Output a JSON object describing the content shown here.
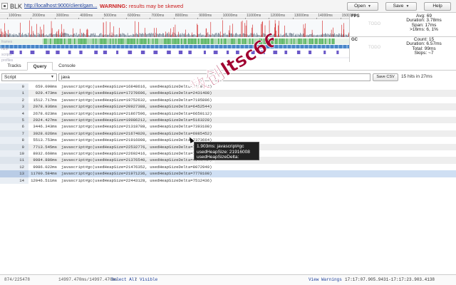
{
  "app": {
    "name": "BLK",
    "url": "http://localhost:9000/client/gam...",
    "warning_label": "WARNING:",
    "warning_text": "results may be skewed"
  },
  "toolbar": {
    "open_label": "Open",
    "save_label": "Save",
    "help_label": "Help"
  },
  "timeline": {
    "ruler_ticks": [
      "1000ms",
      "2000ms",
      "3000ms",
      "4000ms",
      "5000ms",
      "6000ms",
      "7000ms",
      "8000ms",
      "9000ms",
      "10000ms",
      "11000ms",
      "12000ms",
      "13000ms",
      "14000ms",
      "15000ms"
    ],
    "track_labels": [
      "frames",
      "html",
      "scripts",
      "profiles"
    ]
  },
  "fps_panel": {
    "tag": "FPS",
    "todo": "TODO",
    "stats": [
      "Avg: 69",
      "Duration: 3.78ms",
      "Span: 17ms",
      ">16ms: 6, 1%"
    ]
  },
  "gc_panel": {
    "tag": "GC",
    "todo": "TODO",
    "stats": [
      "Count: 15",
      "Duration: 6.57ms",
      "Total: 99ms",
      "Skips: ~7"
    ]
  },
  "tabs": [
    "Tracks",
    "Query",
    "Console"
  ],
  "active_tab": "Query",
  "query": {
    "language": "Script",
    "value": "java",
    "save_csv_label": "Save CSV",
    "hits_text": "15 hits in 27ms"
  },
  "results": [
    {
      "index": "0",
      "time": "659.090ms",
      "text": "javascript#gc(usedHeapSize=16848616, usedHeapSizeDelta=2180744)"
    },
    {
      "index": "1",
      "time": "929.473ms",
      "text": "javascript#gc(usedHeapSize=17270696, usedHeapSizeDelta=2431408)"
    },
    {
      "index": "2",
      "time": "1512.717ms",
      "text": "javascript#gc(usedHeapSize=19752632, usedHeapSizeDelta=7195896)"
    },
    {
      "index": "3",
      "time": "2078.936ms",
      "text": "javascript#gc(usedHeapSize=20927388, usedHeapSizeDelta=6452544)"
    },
    {
      "index": "4",
      "time": "2678.023ms",
      "text": "javascript#gc(usedHeapSize=21867596, usedHeapSizeDelta=6650112)"
    },
    {
      "index": "5",
      "time": "2924.427ms",
      "text": "javascript#gc(usedHeapSize=19986212, usedHeapSizeDelta=5163228)"
    },
    {
      "index": "6",
      "time": "3446.343ms",
      "text": "javascript#gc(usedHeapSize=21318788, usedHeapSizeDelta=7393108)"
    },
    {
      "index": "7",
      "time": "3928.026ms",
      "text": "javascript#gc(usedHeapSize=21674020, usedHeapSizeDelta=6985452)"
    },
    {
      "index": "8",
      "time": "5513.753ms",
      "text": "javascript#gc(usedHeapSize=21916008, usedHeapSizeDelta=7373664)"
    },
    {
      "index": "9",
      "time": "7713.545ms",
      "text": "javascript#gc(usedHeapSize=22532776, usedHeapSizeDelta=7604304)"
    },
    {
      "index": "10",
      "time": "8032.660ms",
      "text": "javascript#gc(usedHeapSize=22692416, usedHeapSizeDelta=7602216)"
    },
    {
      "index": "11",
      "time": "9084.886ms",
      "text": "javascript#gc(usedHeapSize=21376540, usedHeapSizeDelta=4160632)"
    },
    {
      "index": "12",
      "time": "9986.022ms",
      "text": "javascript#gc(usedHeapSize=21476352, usedHeapSizeDelta=8072940)"
    },
    {
      "index": "13",
      "time": "11700.584ms",
      "text": "javascript#gc(usedHeapSize=21971236, usedHeapSizeDelta=7778108)"
    },
    {
      "index": "14",
      "time": "12046.511ms",
      "text": "javascript#gc(usedHeapSize=22443128, usedHeapSizeDelta=7512436)"
    }
  ],
  "selected_row": "13",
  "tooltip": {
    "lines": [
      "1.903ms: javascript#gc",
      "usedHeapSize: 21916008",
      "usedHeapSizeDelta: 7373664"
    ]
  },
  "watermark": {
    "text": "数创ltsc66"
  },
  "statusbar": {
    "count": "874/225478",
    "range": "14997.470ms/14997.470ms",
    "select_all": "Select All",
    "separator": "/",
    "visible": "Visible",
    "view_warnings": "View Warnings",
    "time_range": "17:17:07.905.9431-17:17:23.903.4138"
  },
  "colors": {
    "fps_spike": "#d42020",
    "frame_bar": "#c8d8e8",
    "script_green": "#3aa845",
    "html_blue": "#4a86c8",
    "profile_purple": "#6a58c8",
    "watermark": "#a00030"
  }
}
